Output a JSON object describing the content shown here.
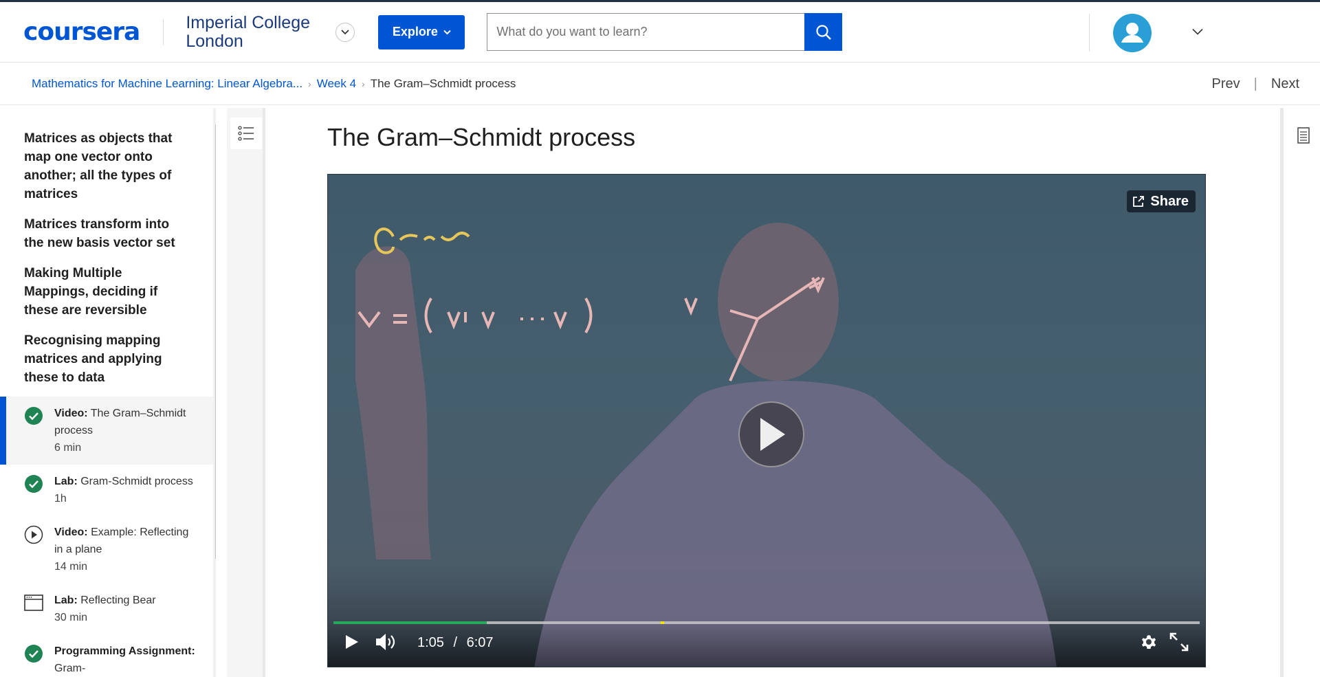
{
  "header": {
    "logo": "coursera",
    "partner": "Imperial College London",
    "explore_label": "Explore",
    "search_placeholder": "What do you want to learn?"
  },
  "breadcrumb": {
    "course": "Mathematics for Machine Learning: Linear Algebra...",
    "week": "Week 4",
    "current": "The Gram–Schmidt process",
    "prev": "Prev",
    "next": "Next"
  },
  "sidebar": {
    "lessons": [
      "Matrices as objects that map one vector onto another; all the types of matrices",
      "Matrices transform into the new basis vector set",
      "Making Multiple Mappings, deciding if these are reversible",
      "Recognising mapping matrices and applying these to data"
    ],
    "items": [
      {
        "kind": "Video:",
        "title": "The Gram–Schmidt process",
        "duration": "6 min",
        "icon": "check-circle-icon",
        "active": true
      },
      {
        "kind": "Lab:",
        "title": "Gram-Schmidt process",
        "duration": "1h",
        "icon": "check-circle-icon",
        "active": false
      },
      {
        "kind": "Video:",
        "title": "Example: Reflecting in a plane",
        "duration": "14 min",
        "icon": "play-circle-icon",
        "active": false
      },
      {
        "kind": "Lab:",
        "title": "Reflecting Bear",
        "duration": "30 min",
        "icon": "lab-window-icon",
        "active": false
      },
      {
        "kind": "Programming Assignment:",
        "title": "Gram-",
        "duration": "",
        "icon": "check-circle-icon",
        "active": false
      }
    ]
  },
  "main": {
    "title": "The Gram–Schmidt process"
  },
  "player": {
    "share_label": "Share",
    "current_time": "1:05",
    "separator": "/",
    "duration": "6:07",
    "progress": 0.177,
    "marker": 0.378
  },
  "colors": {
    "brand": "#0056d2",
    "complete": "#1f8354",
    "progress": "#27a75a"
  }
}
